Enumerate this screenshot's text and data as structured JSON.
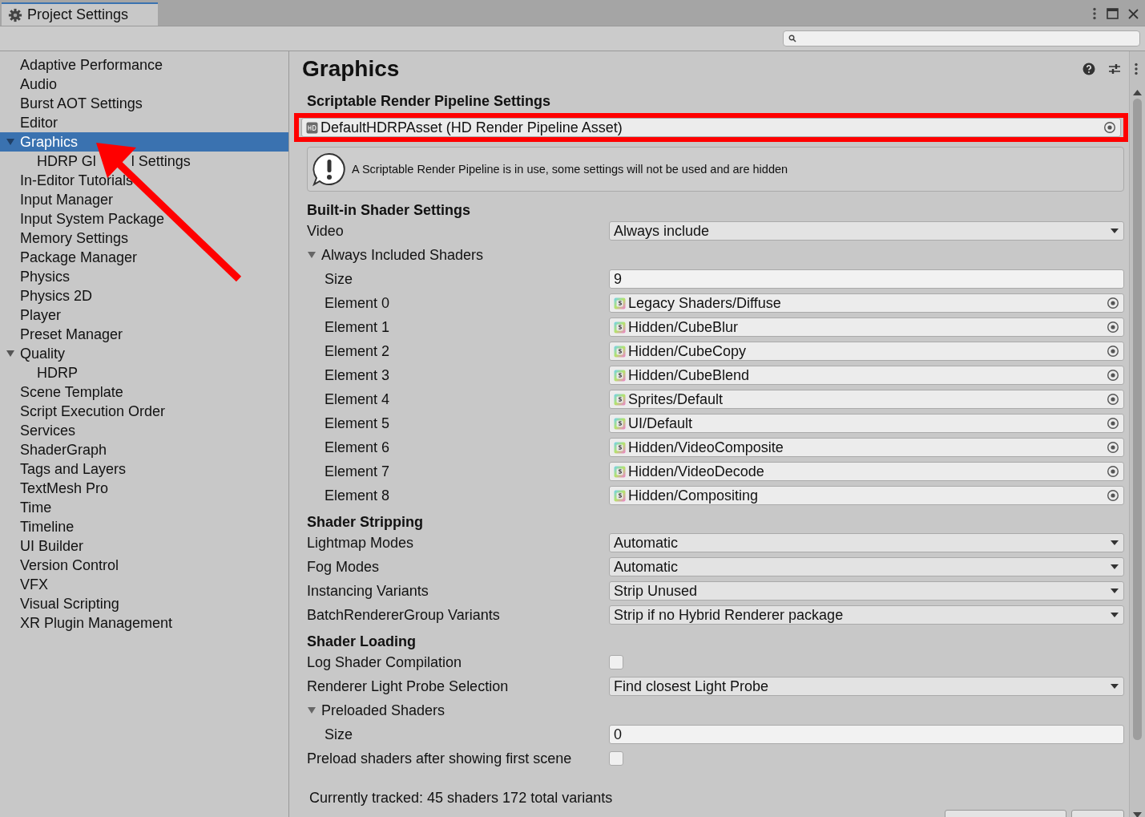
{
  "window": {
    "tab": {
      "title": "Project Settings",
      "selected": true
    }
  },
  "sidebar": {
    "items": [
      {
        "label": "Adaptive Performance",
        "selected": false
      },
      {
        "label": "Audio",
        "selected": false
      },
      {
        "label": "Burst AOT Settings",
        "selected": false
      },
      {
        "label": "Editor",
        "selected": false
      },
      {
        "label": "Graphics",
        "selected": true,
        "expanded": true,
        "children": [
          {
            "label": "HDRP Gl",
            "label_after_arrow": "l Settings",
            "selected": false
          }
        ]
      },
      {
        "label": "In-Editor Tutorials",
        "selected": false
      },
      {
        "label": "Input Manager",
        "selected": false
      },
      {
        "label": "Input System Package",
        "selected": false
      },
      {
        "label": "Memory Settings",
        "selected": false
      },
      {
        "label": "Package Manager",
        "selected": false
      },
      {
        "label": "Physics",
        "selected": false
      },
      {
        "label": "Physics 2D",
        "selected": false
      },
      {
        "label": "Player",
        "selected": false
      },
      {
        "label": "Preset Manager",
        "selected": false
      },
      {
        "label": "Quality",
        "selected": false,
        "expanded": true,
        "children": [
          {
            "label": "HDRP",
            "selected": false
          }
        ]
      },
      {
        "label": "Scene Template",
        "selected": false
      },
      {
        "label": "Script Execution Order",
        "selected": false
      },
      {
        "label": "Services",
        "selected": false
      },
      {
        "label": "ShaderGraph",
        "selected": false
      },
      {
        "label": "Tags and Layers",
        "selected": false
      },
      {
        "label": "TextMesh Pro",
        "selected": false
      },
      {
        "label": "Time",
        "selected": false
      },
      {
        "label": "Timeline",
        "selected": false
      },
      {
        "label": "UI Builder",
        "selected": false
      },
      {
        "label": "Version Control",
        "selected": false
      },
      {
        "label": "VFX",
        "selected": false
      },
      {
        "label": "Visual Scripting",
        "selected": false
      },
      {
        "label": "XR Plugin Management",
        "selected": false
      }
    ]
  },
  "panel": {
    "title": "Graphics",
    "rows": [
      {
        "kind": "heading",
        "label": "Scriptable Render Pipeline Settings"
      },
      {
        "kind": "asset",
        "value": "DefaultHDRPAsset (HD Render Pipeline Asset)",
        "annotated": true
      },
      {
        "kind": "info",
        "text": "A Scriptable Render Pipeline is in use, some settings will not be used and are hidden"
      },
      {
        "kind": "heading",
        "label": "Built-in Shader Settings"
      },
      {
        "kind": "dropdown",
        "label": "Video",
        "value": "Always include"
      },
      {
        "kind": "foldout",
        "label": "Always Included Shaders",
        "expanded": true,
        "children": [
          {
            "kind": "number",
            "label": "Size",
            "value": "9"
          },
          {
            "kind": "shader",
            "label": "Element 0",
            "value": "Legacy Shaders/Diffuse"
          },
          {
            "kind": "shader",
            "label": "Element 1",
            "value": "Hidden/CubeBlur"
          },
          {
            "kind": "shader",
            "label": "Element 2",
            "value": "Hidden/CubeCopy"
          },
          {
            "kind": "shader",
            "label": "Element 3",
            "value": "Hidden/CubeBlend"
          },
          {
            "kind": "shader",
            "label": "Element 4",
            "value": "Sprites/Default"
          },
          {
            "kind": "shader",
            "label": "Element 5",
            "value": "UI/Default"
          },
          {
            "kind": "shader",
            "label": "Element 6",
            "value": "Hidden/VideoComposite"
          },
          {
            "kind": "shader",
            "label": "Element 7",
            "value": "Hidden/VideoDecode"
          },
          {
            "kind": "shader",
            "label": "Element 8",
            "value": "Hidden/Compositing"
          }
        ]
      },
      {
        "kind": "heading",
        "label": "Shader Stripping"
      },
      {
        "kind": "dropdown",
        "label": "Lightmap Modes",
        "value": "Automatic"
      },
      {
        "kind": "dropdown",
        "label": "Fog Modes",
        "value": "Automatic"
      },
      {
        "kind": "dropdown",
        "label": "Instancing Variants",
        "value": "Strip Unused"
      },
      {
        "kind": "dropdown",
        "label": "BatchRendererGroup Variants",
        "value": "Strip if no Hybrid Renderer package"
      },
      {
        "kind": "heading",
        "label": "Shader Loading"
      },
      {
        "kind": "checkbox",
        "label": "Log Shader Compilation",
        "checked": false
      },
      {
        "kind": "dropdown",
        "label": "Renderer Light Probe Selection",
        "value": "Find closest Light Probe"
      },
      {
        "kind": "foldout",
        "label": "Preloaded Shaders",
        "expanded": true,
        "children": [
          {
            "kind": "number",
            "label": "Size",
            "value": "0"
          }
        ]
      },
      {
        "kind": "checkbox",
        "label": "Preload shaders after showing first scene",
        "checked": false
      },
      {
        "kind": "note",
        "text": "Currently tracked: 45 shaders 172 total variants"
      }
    ]
  },
  "annotation": {
    "arrow": true
  }
}
